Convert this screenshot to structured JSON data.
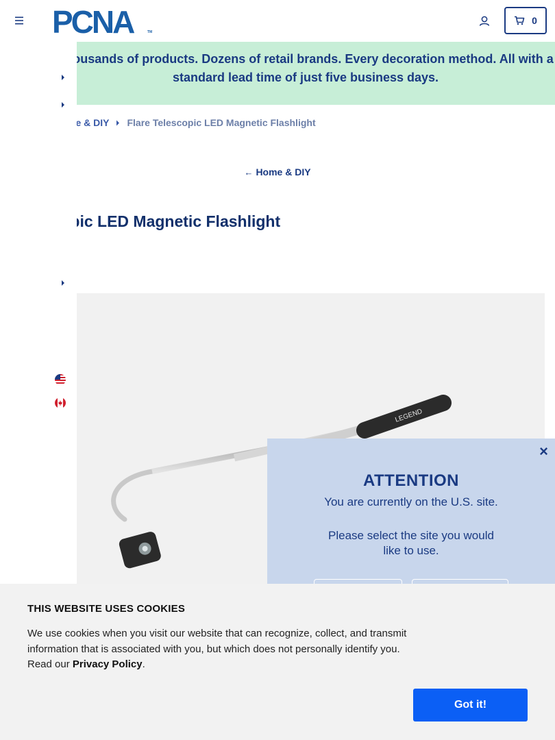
{
  "header": {
    "logo_text": "PCNA",
    "logo_tm": "TM",
    "cart_count": "0"
  },
  "promo": {
    "text": "Thousands of products. Dozens of retail brands. Every decoration method. All with a standard lead time of just five business days."
  },
  "breadcrumb": {
    "parent": "me & DIY",
    "current": "Flare Telescopic LED Magnetic Flashlight"
  },
  "back_link": {
    "label": "Home & DIY"
  },
  "product": {
    "title": "escopic LED Magnetic Flashlight",
    "image_brand_text": "LEGEND"
  },
  "attention": {
    "title": "ATTENTION",
    "line1": "You are currently on the U.S. site.",
    "line2": "Please select the site you would",
    "line3": "like to use.",
    "close_icon": "close-icon"
  },
  "cookie": {
    "title": "THIS WEBSITE USES COOKIES",
    "text_before": "We use cookies when you visit our website that can recognize, collect, and transmit information that is associated with you, but which does not personally identify you. Read our ",
    "link": "Privacy Policy",
    "text_after": ".",
    "button": "Got it!"
  },
  "colors": {
    "brand_navy": "#1a3a82",
    "promo_bg": "#c7eed7",
    "modal_bg": "#c8d6ec",
    "cookie_button": "#0b5ff5"
  }
}
